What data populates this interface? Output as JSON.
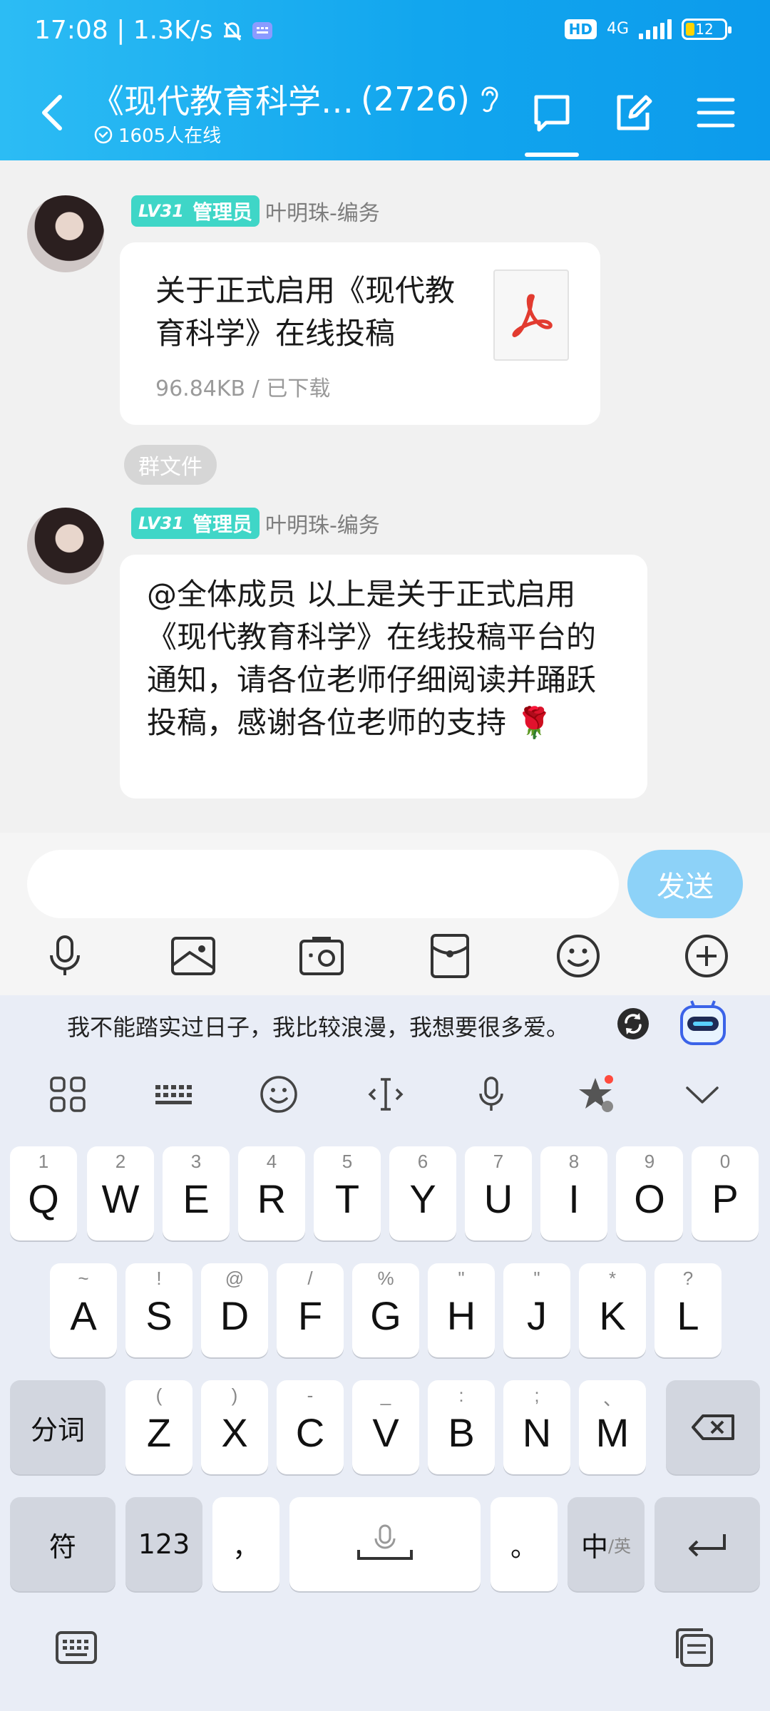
{
  "status_bar": {
    "time_speed": "17:08 | 1.3K/s",
    "network_type": "4G",
    "hd_label": "HD",
    "battery": "12"
  },
  "header": {
    "title": "《现代教育科学…",
    "member_count": "(2726)",
    "online": "1605人在线"
  },
  "messages": [
    {
      "role": "管理员",
      "level": "LV31",
      "sender": "叶明珠-编务",
      "file_title": "关于正式启用《现代教育科学》在线投稿",
      "file_meta": "96.84KB / 已下载",
      "tag": "群文件"
    },
    {
      "role": "管理员",
      "level": "LV31",
      "sender": "叶明珠-编务",
      "text": "@全体成员 以上是关于正式启用《现代教育科学》在线投稿平台的通知，请各位老师仔细阅读并踊跃投稿，感谢各位老师的支持",
      "emoji": "🌹"
    }
  ],
  "input": {
    "placeholder": "",
    "send_label": "发送"
  },
  "keyboard": {
    "suggestion": "我不能踏实过日子，我比较浪漫，我想要很多爱。",
    "row1": [
      {
        "hint": "1",
        "key": "Q"
      },
      {
        "hint": "2",
        "key": "W"
      },
      {
        "hint": "3",
        "key": "E"
      },
      {
        "hint": "4",
        "key": "R"
      },
      {
        "hint": "5",
        "key": "T"
      },
      {
        "hint": "6",
        "key": "Y"
      },
      {
        "hint": "7",
        "key": "U"
      },
      {
        "hint": "8",
        "key": "I"
      },
      {
        "hint": "9",
        "key": "O"
      },
      {
        "hint": "0",
        "key": "P"
      }
    ],
    "row2": [
      {
        "hint": "~",
        "key": "A"
      },
      {
        "hint": "!",
        "key": "S"
      },
      {
        "hint": "@",
        "key": "D"
      },
      {
        "hint": "/",
        "key": "F"
      },
      {
        "hint": "%",
        "key": "G"
      },
      {
        "hint": "\"",
        "key": "H"
      },
      {
        "hint": "\"",
        "key": "J"
      },
      {
        "hint": "*",
        "key": "K"
      },
      {
        "hint": "?",
        "key": "L"
      }
    ],
    "row3": [
      {
        "hint": "(",
        "key": "Z"
      },
      {
        "hint": ")",
        "key": "X"
      },
      {
        "hint": "-",
        "key": "C"
      },
      {
        "hint": "_",
        "key": "V"
      },
      {
        "hint": ":",
        "key": "B"
      },
      {
        "hint": ";",
        "key": "N"
      },
      {
        "hint": "、",
        "key": "M"
      }
    ],
    "fenci": "分词",
    "fu": "符",
    "num": "123",
    "comma": "，",
    "period": "。",
    "lang_main": "中",
    "lang_sub": "/英"
  }
}
